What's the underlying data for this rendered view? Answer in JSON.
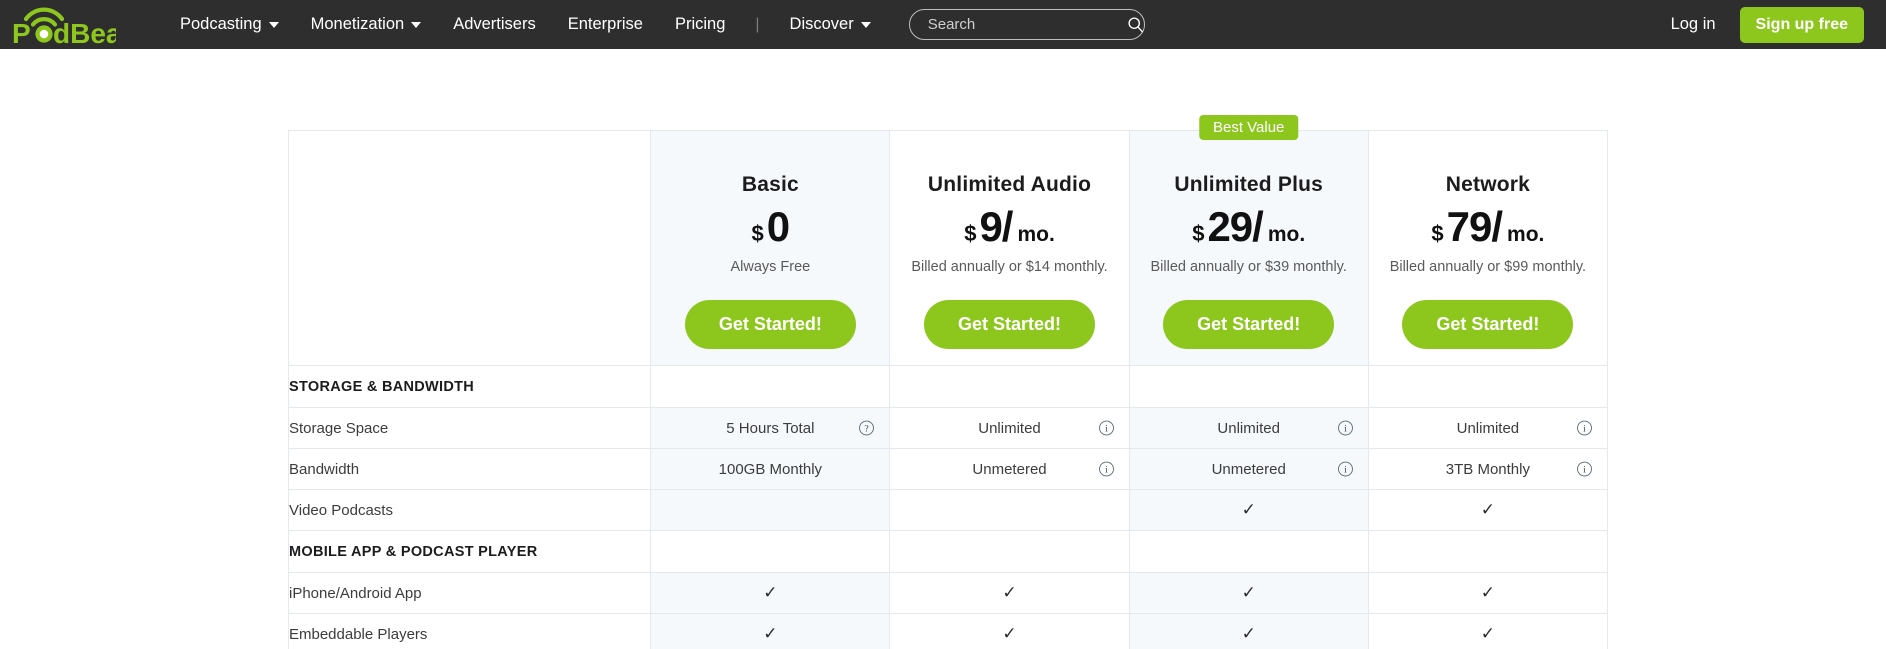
{
  "nav": {
    "logo_text": "PodBean",
    "items": [
      {
        "label": "Podcasting",
        "has_caret": true
      },
      {
        "label": "Monetization",
        "has_caret": true
      },
      {
        "label": "Advertisers",
        "has_caret": false
      },
      {
        "label": "Enterprise",
        "has_caret": false
      },
      {
        "label": "Pricing",
        "has_caret": false
      }
    ],
    "separator": "|",
    "discover": {
      "label": "Discover",
      "has_caret": true
    },
    "search": {
      "placeholder": "Search",
      "value": "",
      "icon": "search-icon"
    },
    "login_label": "Log in",
    "signup_label": "Sign up free",
    "bg_color": "#2e2e2e",
    "accent_color": "#8dc71e"
  },
  "pricing": {
    "feature_col_header": "",
    "plans": [
      {
        "name": "Basic",
        "badge": "",
        "currency": "$",
        "amount": "0",
        "per": "",
        "billing": "Always Free",
        "cta": "Get Started!",
        "tinted": true
      },
      {
        "name": "Unlimited Audio",
        "badge": "",
        "currency": "$",
        "amount": "9/",
        "per": "mo.",
        "billing": "Billed annually or $14 monthly.",
        "cta": "Get Started!",
        "tinted": false
      },
      {
        "name": "Unlimited Plus",
        "badge": "Best Value",
        "currency": "$",
        "amount": "29/",
        "per": "mo.",
        "billing": "Billed annually or $39 monthly.",
        "cta": "Get Started!",
        "tinted": true
      },
      {
        "name": "Network",
        "badge": "",
        "currency": "$",
        "amount": "79/",
        "per": "mo.",
        "billing": "Billed annually or $99 monthly.",
        "cta": "Get Started!",
        "tinted": false
      }
    ],
    "sections": [
      {
        "title": "STORAGE & BANDWIDTH",
        "rows": [
          {
            "label": "Storage Space",
            "cells": [
              {
                "text": "5 Hours Total",
                "icon": "question-icon"
              },
              {
                "text": "Unlimited",
                "icon": "info-icon"
              },
              {
                "text": "Unlimited",
                "icon": "info-icon"
              },
              {
                "text": "Unlimited",
                "icon": "info-icon"
              }
            ]
          },
          {
            "label": "Bandwidth",
            "cells": [
              {
                "text": "100GB Monthly",
                "icon": ""
              },
              {
                "text": "Unmetered",
                "icon": "info-icon"
              },
              {
                "text": "Unmetered",
                "icon": "info-icon"
              },
              {
                "text": "3TB Monthly",
                "icon": "info-icon"
              }
            ]
          },
          {
            "label": "Video Podcasts",
            "cells": [
              {
                "text": "",
                "icon": ""
              },
              {
                "text": "",
                "icon": ""
              },
              {
                "text": "✓",
                "icon": ""
              },
              {
                "text": "✓",
                "icon": ""
              }
            ]
          }
        ]
      },
      {
        "title": "MOBILE APP & PODCAST PLAYER",
        "rows": [
          {
            "label": "iPhone/Android App",
            "cells": [
              {
                "text": "✓",
                "icon": ""
              },
              {
                "text": "✓",
                "icon": ""
              },
              {
                "text": "✓",
                "icon": ""
              },
              {
                "text": "✓",
                "icon": ""
              }
            ]
          },
          {
            "label": "Embeddable Players",
            "cells": [
              {
                "text": "✓",
                "icon": ""
              },
              {
                "text": "✓",
                "icon": ""
              },
              {
                "text": "✓",
                "icon": ""
              },
              {
                "text": "✓",
                "icon": ""
              }
            ]
          }
        ]
      }
    ]
  }
}
